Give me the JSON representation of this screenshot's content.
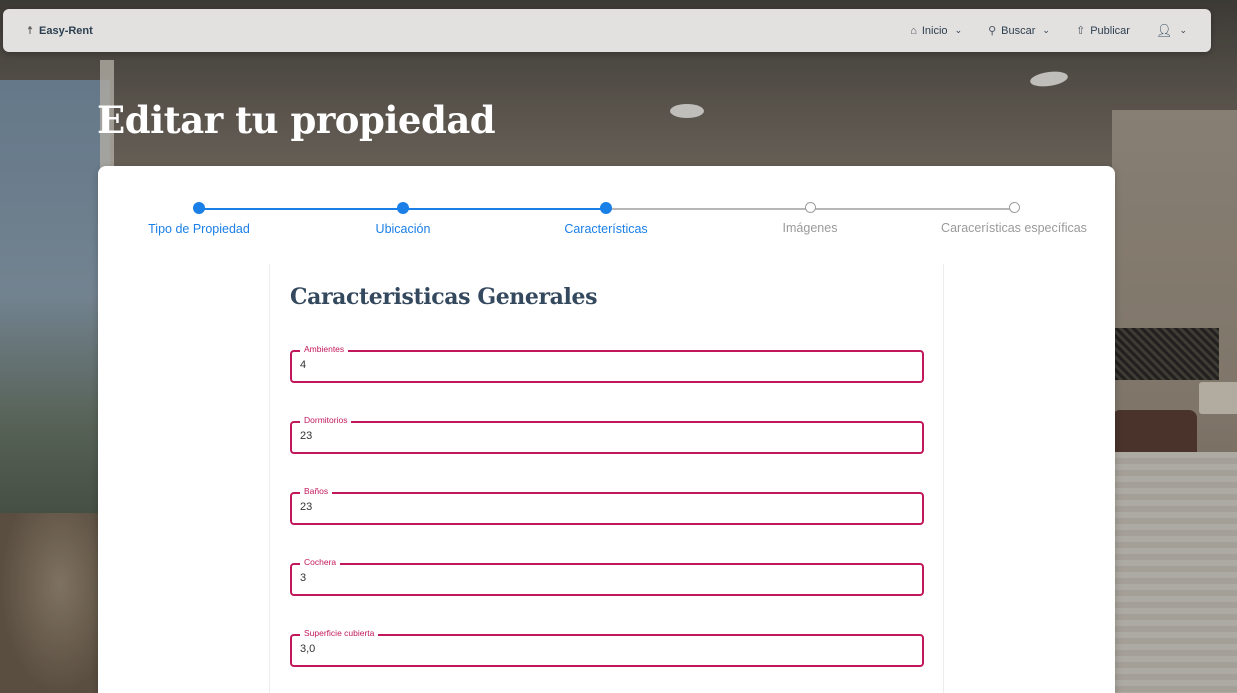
{
  "navbar": {
    "brand": "Easy-Rent",
    "items": [
      {
        "label": "Inicio",
        "icon": "home-icon"
      },
      {
        "label": "Buscar",
        "icon": "search-icon"
      },
      {
        "label": "Publicar",
        "icon": "upload-icon"
      }
    ],
    "user_icon": "user-icon"
  },
  "page": {
    "title": "Editar tu propiedad"
  },
  "stepper": {
    "steps": [
      {
        "label": "Tipo de Propiedad",
        "state": "completed"
      },
      {
        "label": "Ubicación",
        "state": "completed"
      },
      {
        "label": "Características",
        "state": "active"
      },
      {
        "label": "Imágenes",
        "state": "pending"
      },
      {
        "label": "Caracerísticas específicas",
        "state": "pending"
      }
    ],
    "colors": {
      "active": "#1a7fe6",
      "inactive": "#9e9e9e"
    }
  },
  "form": {
    "section_title": "Caracteristicas Generales",
    "accent_color": "#c2185b",
    "fields": [
      {
        "label": "Ambientes",
        "value": "4"
      },
      {
        "label": "Dormitorios",
        "value": "23"
      },
      {
        "label": "Baños",
        "value": "23"
      },
      {
        "label": "Cochera",
        "value": "3"
      },
      {
        "label": "Superficie cubierta",
        "value": "3,0"
      }
    ]
  }
}
